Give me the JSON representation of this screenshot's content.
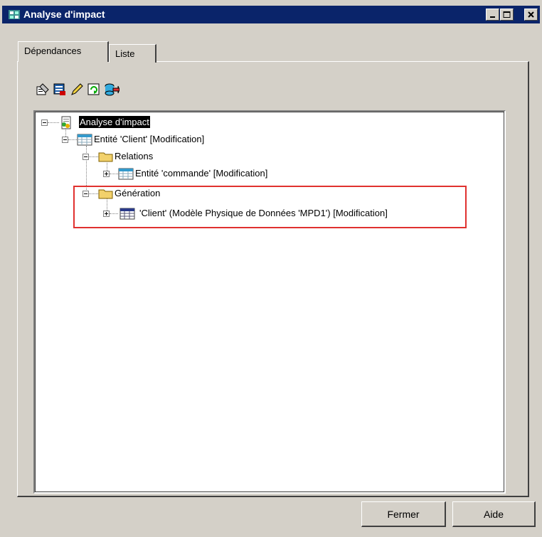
{
  "window": {
    "title": "Analyse d'impact",
    "controls": [
      "minimize-icon",
      "maximize-icon",
      "close-icon"
    ]
  },
  "tabs": [
    {
      "label": "Dépendances",
      "active": true
    },
    {
      "label": "Liste",
      "active": false
    }
  ],
  "toolbar": {
    "icons": [
      "properties-icon",
      "tree-view-icon",
      "edit-pencil-icon",
      "refresh-icon",
      "export-icon"
    ]
  },
  "tree": {
    "root": {
      "label": "Analyse d'impact",
      "selected": true
    },
    "entity_client": {
      "label": "Entité 'Client' [Modification]"
    },
    "relations": {
      "label": "Relations"
    },
    "entity_commande": {
      "label": "Entité 'commande' [Modification]"
    },
    "generation": {
      "label": "Génération"
    },
    "pdm_client": {
      "label": "'Client' (Modèle Physique de Données 'MPD1') [Modification]"
    }
  },
  "buttons": {
    "close_label": "Fermer",
    "help_label": "Aide"
  },
  "colors": {
    "titlebar": "#0a246a",
    "highlight": "#e0312f",
    "dialog": "#d4d0c8"
  }
}
